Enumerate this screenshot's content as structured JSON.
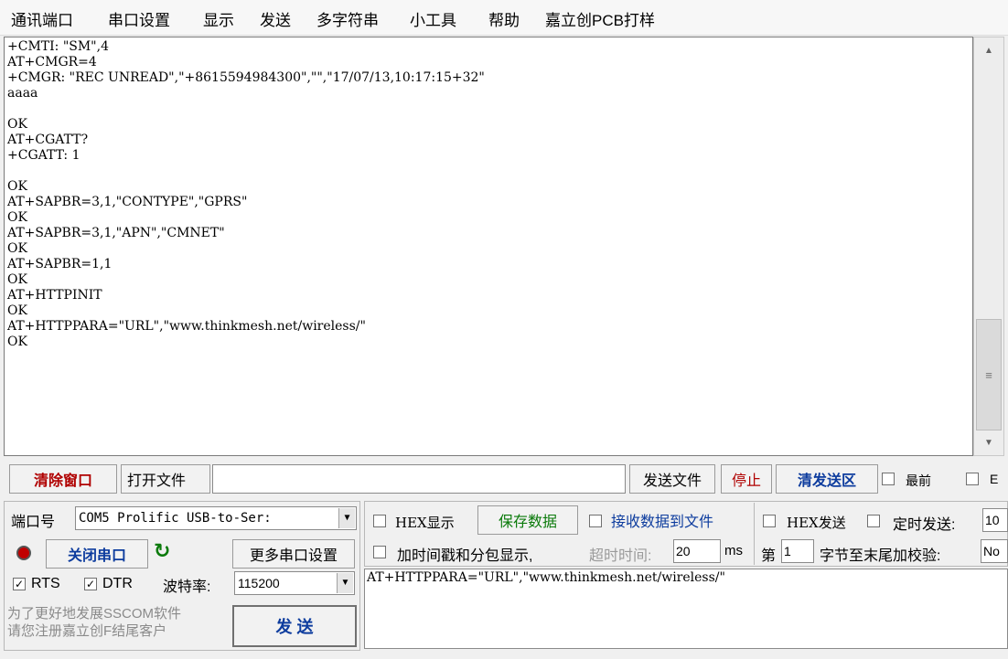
{
  "menu": {
    "items": [
      "通讯端口",
      "串口设置",
      "显示",
      "发送",
      "多字符串",
      "小工具",
      "帮助",
      "嘉立创PCB打样"
    ]
  },
  "receive": {
    "text": "+CMTI: \"SM\",4\nAT+CMGR=4\n+CMGR: \"REC UNREAD\",\"+8615594984300\",\"\",\"17/07/13,10:17:15+32\"\naaaa\n\nOK\nAT+CGATT?\n+CGATT: 1\n\nOK\nAT+SAPBR=3,1,\"CONTYPE\",\"GPRS\"\nOK\nAT+SAPBR=3,1,\"APN\",\"CMNET\"\nOK\nAT+SAPBR=1,1\nOK\nAT+HTTPINIT\nOK\nAT+HTTPPARA=\"URL\",\"www.thinkmesh.net/wireless/\"\nOK"
  },
  "toolbar": {
    "clear_window": "清除窗口",
    "open_file": "打开文件",
    "file_path": "",
    "send_file": "发送文件",
    "stop": "停止",
    "clear_send": "清发送区",
    "topmost": "最前",
    "e_label": "E"
  },
  "port": {
    "label": "端口号",
    "value": "COM5 Prolific USB-to-Ser:",
    "close_port": "关闭串口",
    "more_settings": "更多串口设置",
    "rts": "RTS",
    "dtr": "DTR",
    "baud_label": "波特率:",
    "baud_value": "115200"
  },
  "display_opts": {
    "hex_display": "HEX显示",
    "save_data": "保存数据",
    "recv_to_file": "接收数据到文件",
    "hex_send": "HEX发送",
    "timed_send": "定时发送:",
    "timed_value": "10",
    "timestamp": "加时间戳和分包显示,",
    "timeout_label": "超时时间:",
    "timeout_value": "20",
    "ms": "ms",
    "di": "第",
    "byte_index": "1",
    "checksum_label": "字节至末尾加校验:",
    "checksum_value": "No"
  },
  "promo": {
    "line1": "为了更好地发展SSCOM软件",
    "line2": "请您注册嘉立创F结尾客户"
  },
  "send": {
    "button": "发  送",
    "text": "AT+HTTPPARA=\"URL\",\"www.thinkmesh.net/wireless/\""
  },
  "colors": {
    "red": "#b00000",
    "blue": "#0d3c9e",
    "green": "#0a7a0a",
    "status_light": "#c00000"
  }
}
